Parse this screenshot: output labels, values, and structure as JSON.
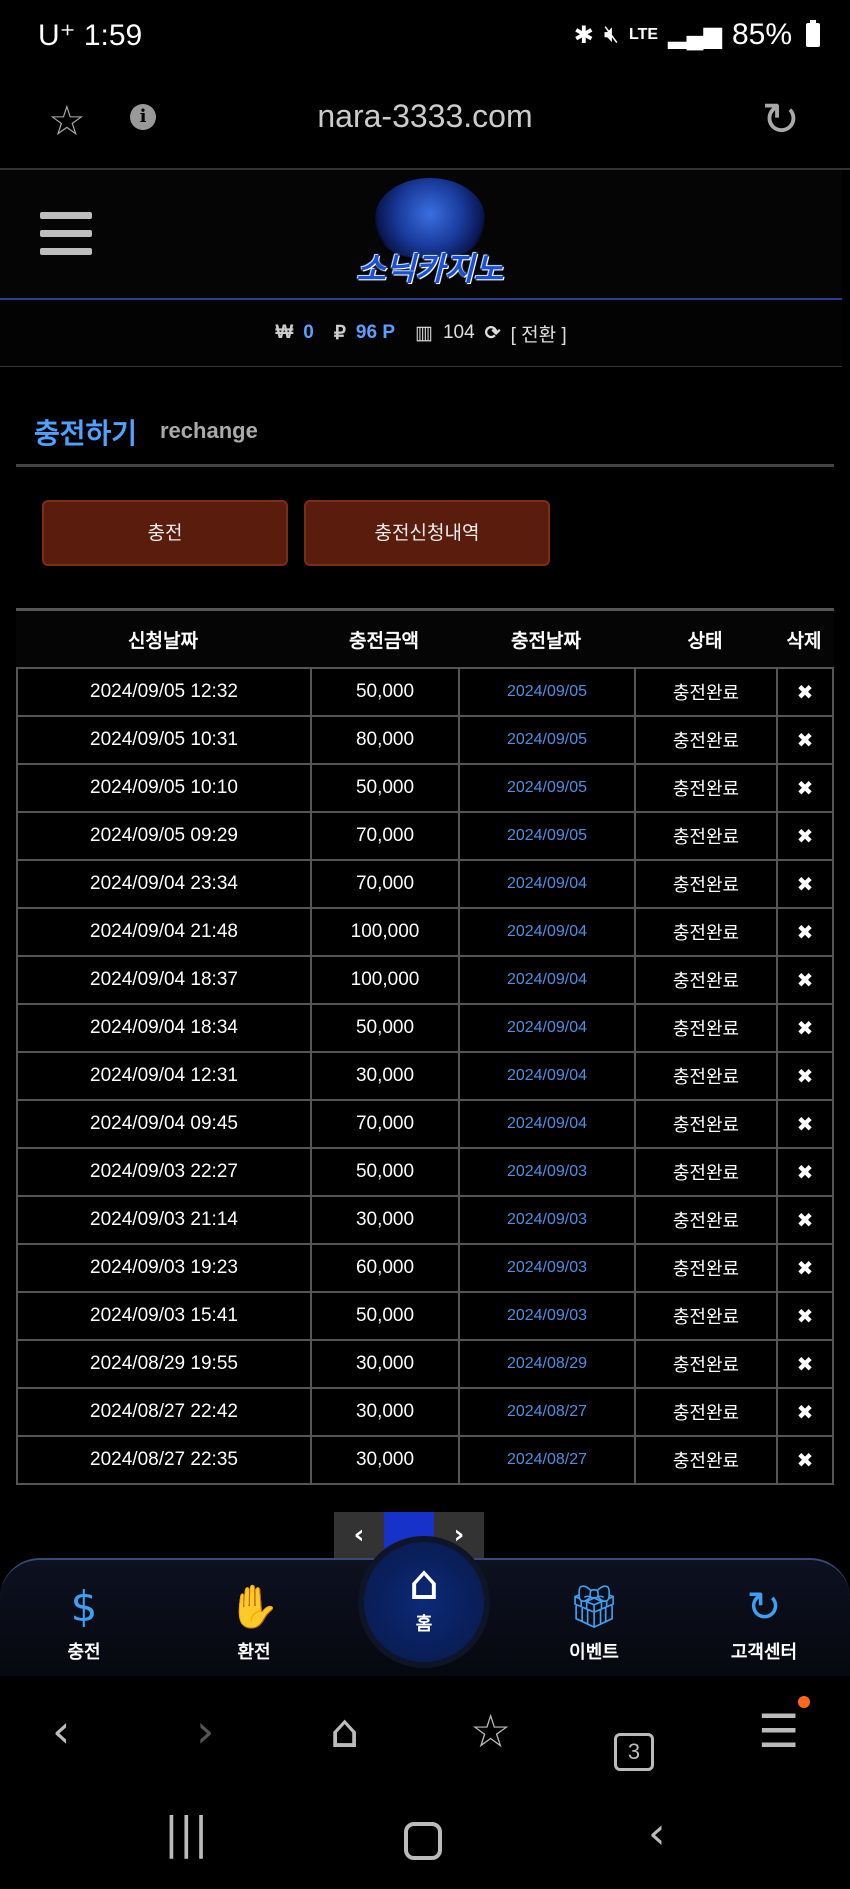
{
  "status_bar": {
    "carrier": "U⁺",
    "time": "1:59",
    "network": "LTE",
    "battery": "85%"
  },
  "browser": {
    "url": "nara-3333.com"
  },
  "site": {
    "logo_text": "소닉카지노"
  },
  "balance": {
    "won_symbol": "₩",
    "won_value": "0",
    "point_symbol": "₽",
    "point_value": "96 P",
    "chip_value": "104",
    "switch_label": "[ 전환 ]"
  },
  "page": {
    "title_ko": "충전하기",
    "title_en": "rechange"
  },
  "tabs": {
    "charge": "충전",
    "history": "충전신청내역"
  },
  "table": {
    "headers": [
      "신청날짜",
      "충전금액",
      "충전날짜",
      "상태",
      "삭제"
    ],
    "delete_glyph": "✖",
    "rows": [
      {
        "requested": "2024/09/05 12:32",
        "amount": "50,000",
        "charged": "2024/09/05",
        "status": "충전완료"
      },
      {
        "requested": "2024/09/05 10:31",
        "amount": "80,000",
        "charged": "2024/09/05",
        "status": "충전완료"
      },
      {
        "requested": "2024/09/05 10:10",
        "amount": "50,000",
        "charged": "2024/09/05",
        "status": "충전완료"
      },
      {
        "requested": "2024/09/05 09:29",
        "amount": "70,000",
        "charged": "2024/09/05",
        "status": "충전완료"
      },
      {
        "requested": "2024/09/04 23:34",
        "amount": "70,000",
        "charged": "2024/09/04",
        "status": "충전완료"
      },
      {
        "requested": "2024/09/04 21:48",
        "amount": "100,000",
        "charged": "2024/09/04",
        "status": "충전완료"
      },
      {
        "requested": "2024/09/04 18:37",
        "amount": "100,000",
        "charged": "2024/09/04",
        "status": "충전완료"
      },
      {
        "requested": "2024/09/04 18:34",
        "amount": "50,000",
        "charged": "2024/09/04",
        "status": "충전완료"
      },
      {
        "requested": "2024/09/04 12:31",
        "amount": "30,000",
        "charged": "2024/09/04",
        "status": "충전완료"
      },
      {
        "requested": "2024/09/04 09:45",
        "amount": "70,000",
        "charged": "2024/09/04",
        "status": "충전완료"
      },
      {
        "requested": "2024/09/03 22:27",
        "amount": "50,000",
        "charged": "2024/09/03",
        "status": "충전완료"
      },
      {
        "requested": "2024/09/03 21:14",
        "amount": "30,000",
        "charged": "2024/09/03",
        "status": "충전완료"
      },
      {
        "requested": "2024/09/03 19:23",
        "amount": "60,000",
        "charged": "2024/09/03",
        "status": "충전완료"
      },
      {
        "requested": "2024/09/03 15:41",
        "amount": "50,000",
        "charged": "2024/09/03",
        "status": "충전완료"
      },
      {
        "requested": "2024/08/29 19:55",
        "amount": "30,000",
        "charged": "2024/08/29",
        "status": "충전완료"
      },
      {
        "requested": "2024/08/27 22:42",
        "amount": "30,000",
        "charged": "2024/08/27",
        "status": "충전완료"
      },
      {
        "requested": "2024/08/27 22:35",
        "amount": "30,000",
        "charged": "2024/08/27",
        "status": "충전완료"
      }
    ]
  },
  "pagination": {
    "prev": "‹",
    "next": "›"
  },
  "bottom_nav": {
    "charge": "충전",
    "exchange": "환전",
    "home": "홈",
    "event": "이벤트",
    "support": "고객센터"
  },
  "browser_toolbar": {
    "tab_count": "3"
  },
  "colors": {
    "accent_blue": "#4da3ff",
    "button_brown": "#5a1c0d",
    "page_active": "#1632c8"
  }
}
